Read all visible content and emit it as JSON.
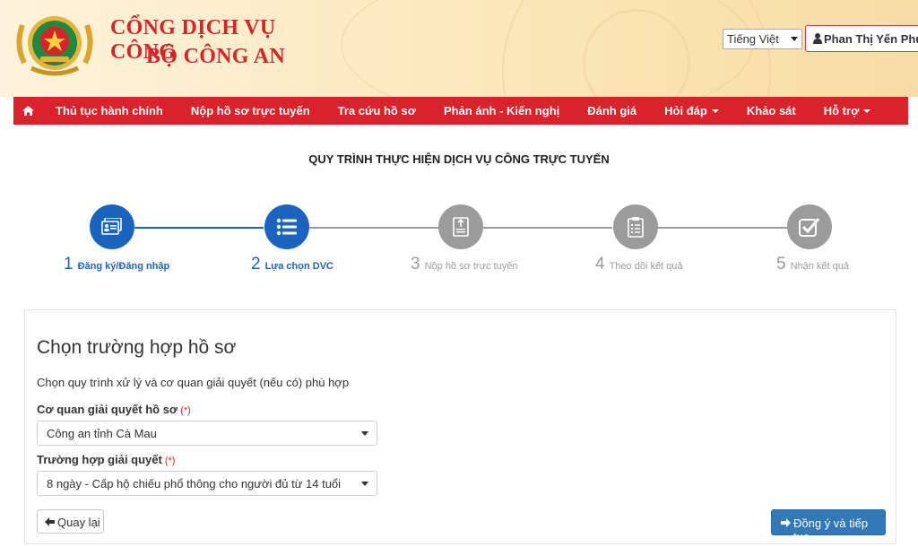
{
  "header": {
    "title_line1": "CỔNG DỊCH VỤ CÔNG",
    "title_line2": "BỘ CÔNG AN",
    "language": "Tiếng Việt",
    "user_name": "Phan Thị Yến Phư"
  },
  "nav": {
    "items": [
      {
        "label": "Thủ tục hành chính"
      },
      {
        "label": "Nộp hồ sơ trực tuyến"
      },
      {
        "label": "Tra cứu hồ sơ"
      },
      {
        "label": "Phản ánh - Kiến nghị"
      },
      {
        "label": "Đánh giá"
      },
      {
        "label": "Hỏi đáp"
      },
      {
        "label": "Khảo sát"
      },
      {
        "label": "Hỗ trợ"
      }
    ]
  },
  "process": {
    "title": "QUY TRÌNH THỰC HIỆN DỊCH VỤ CÔNG TRỰC TUYẾN",
    "steps": [
      {
        "num": "1",
        "label": "Đăng ký/Đăng nhập",
        "state": "active",
        "icon": "id-card-icon"
      },
      {
        "num": "2",
        "label": "Lựa chọn DVC",
        "state": "active",
        "icon": "list-icon"
      },
      {
        "num": "3",
        "label": "Nộp hồ sơ trực tuyến",
        "state": "inactive",
        "icon": "document-upload-icon"
      },
      {
        "num": "4",
        "label": "Theo dõi kết quả",
        "state": "inactive",
        "icon": "clipboard-icon"
      },
      {
        "num": "5",
        "label": "Nhận kết quả",
        "state": "inactive",
        "icon": "checkbox-icon"
      }
    ]
  },
  "form": {
    "title": "Chọn trường hợp hồ sơ",
    "description": "Chọn quy trình xử lý và cơ quan giải quyết (nếu có) phù hợp",
    "agency_label": "Cơ quan giải quyết hồ sơ",
    "agency_value": "Công an tỉnh Cà Mau",
    "case_label": "Trường hợp giải quyết",
    "case_value": "8 ngày - Cấp hộ chiếu phổ thông cho người đủ từ 14 tuổi",
    "required_mark": "(*)",
    "back_label": "Quay lại",
    "next_label": "Đồng ý và tiếp tục"
  },
  "colors": {
    "brand_red": "#d8232a",
    "active_blue": "#1a64c0",
    "inactive_gray": "#9b9b9b",
    "primary_button": "#3379b7"
  }
}
